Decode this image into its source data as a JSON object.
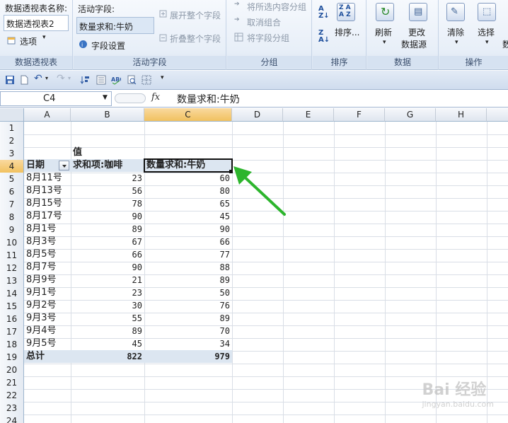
{
  "ribbon": {
    "pivot_name_label": "数据透视表名称:",
    "pivot_name_value": "数据透视表2",
    "options_label": "选项",
    "group_pivot": "数据透视表",
    "active_field_label": "活动字段:",
    "active_field_value": "数量求和:牛奶",
    "field_settings": "字段设置",
    "expand_field": "展开整个字段",
    "collapse_field": "折叠整个字段",
    "group_active": "活动字段",
    "group_selection": "将所选内容分组",
    "ungroup": "取消组合",
    "group_field": "将字段分组",
    "group_grouping": "分组",
    "sort_label": "排序...",
    "group_sort": "排序",
    "refresh_label": "刷新",
    "change_source_label_1": "更改",
    "change_source_label_2": "数据源",
    "group_data": "数据",
    "clear_label": "清除",
    "select_label": "选择",
    "group_actions": "操作",
    "cut_off_label": "数"
  },
  "formula_bar": {
    "name_box": "C4",
    "fx": "fx",
    "formula": "数量求和:牛奶"
  },
  "columns": [
    "A",
    "B",
    "C",
    "D",
    "E",
    "F",
    "G",
    "H"
  ],
  "rows": [
    "1",
    "2",
    "3",
    "4",
    "5",
    "6",
    "7",
    "8",
    "9",
    "10",
    "11",
    "12",
    "13",
    "14",
    "15",
    "16",
    "17",
    "18",
    "19",
    "20",
    "21",
    "22",
    "23",
    "24"
  ],
  "pivot": {
    "value_header": "值",
    "row_field": "日期",
    "col_b_header": "求和项:咖啡",
    "col_c_header": "数量求和:牛奶",
    "data": [
      {
        "date": "8月11号",
        "coffee": "23",
        "milk": "60"
      },
      {
        "date": "8月13号",
        "coffee": "56",
        "milk": "80"
      },
      {
        "date": "8月15号",
        "coffee": "78",
        "milk": "65"
      },
      {
        "date": "8月17号",
        "coffee": "90",
        "milk": "45"
      },
      {
        "date": "8月1号",
        "coffee": "89",
        "milk": "90"
      },
      {
        "date": "8月3号",
        "coffee": "67",
        "milk": "66"
      },
      {
        "date": "8月5号",
        "coffee": "66",
        "milk": "77"
      },
      {
        "date": "8月7号",
        "coffee": "90",
        "milk": "88"
      },
      {
        "date": "8月9号",
        "coffee": "21",
        "milk": "89"
      },
      {
        "date": "9月1号",
        "coffee": "23",
        "milk": "50"
      },
      {
        "date": "9月2号",
        "coffee": "30",
        "milk": "76"
      },
      {
        "date": "9月3号",
        "coffee": "55",
        "milk": "89"
      },
      {
        "date": "9月4号",
        "coffee": "89",
        "milk": "70"
      },
      {
        "date": "9月5号",
        "coffee": "45",
        "milk": "34"
      }
    ],
    "total_label": "总计",
    "total_coffee": "822",
    "total_milk": "979"
  },
  "watermark": {
    "brand": "Bai 经验",
    "url": "jingyan.baidu.com"
  },
  "colors": {
    "accent_arrow": "#2db52d",
    "header_band": "#dce6f1",
    "active_header": "#f1c15f"
  }
}
